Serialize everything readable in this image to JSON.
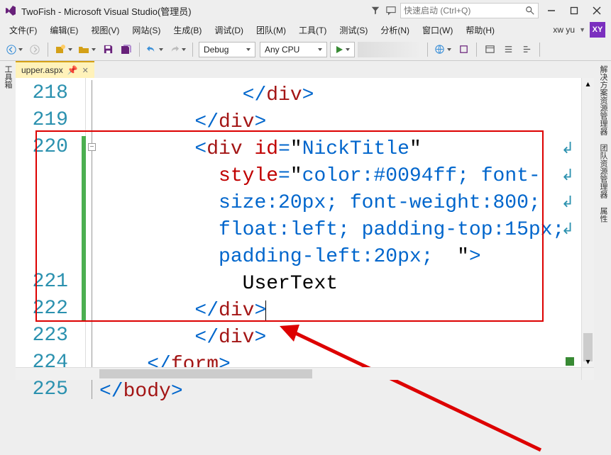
{
  "title": "TwoFish - Microsoft Visual Studio(管理员)",
  "quicklaunch_placeholder": "快速启动 (Ctrl+Q)",
  "menus": {
    "file": "文件(F)",
    "edit": "编辑(E)",
    "view": "视图(V)",
    "site": "网站(S)",
    "build": "生成(B)",
    "debug": "调试(D)",
    "team": "团队(M)",
    "tools": "工具(T)",
    "test": "测试(S)",
    "analyze": "分析(N)",
    "window": "窗口(W)",
    "help": "帮助(H)"
  },
  "user": {
    "name": "xw yu",
    "initials": "XY"
  },
  "toolbar": {
    "config": "Debug",
    "platform": "Any CPU"
  },
  "left_tabs": {
    "toolbox": "工具箱"
  },
  "right_tabs": {
    "solution": "解决方案资源管理器",
    "team": "团队资源管理器",
    "props": "属性"
  },
  "doc_tab": {
    "label": "upper.aspx"
  },
  "lines": {
    "l218": "218",
    "l219": "219",
    "l220": "220",
    "l221": "221",
    "l222": "222",
    "l223": "223",
    "l224": "224",
    "l225": "225"
  },
  "code": {
    "indent218": "            ",
    "cdiv": "</",
    "div_word": "div",
    "gt": ">",
    "lt": "<",
    "indent219": "        ",
    "indent220": "        ",
    "sp_after_div": " ",
    "id_attr": "id",
    "eq": "=",
    "q": "\"",
    "nick": "NickTitle",
    "indent_style": "          ",
    "style_attr": "style",
    "style_v1": "color:#0094ff; font-",
    "style_v2": "size:20px; font-weight:800;",
    "style_v3": "float:left; padding-top:15px;",
    "style_v4": "padding-left:20px;  ",
    "indent221": "            ",
    "usertext": "UserText",
    "indent222": "        ",
    "indent223": "        ",
    "indent224": "    ",
    "form_word": "form",
    "indent225": "",
    "body_word": "body"
  }
}
